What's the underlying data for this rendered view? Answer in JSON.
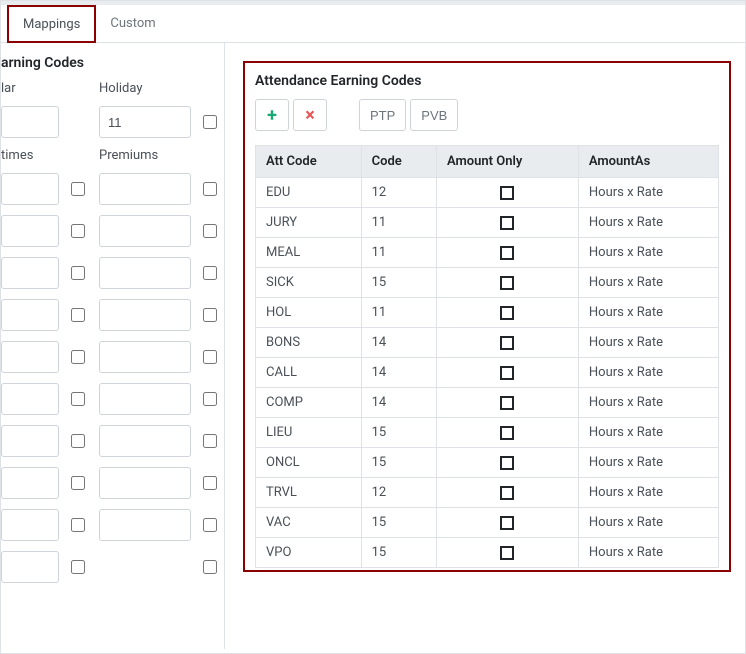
{
  "tabs": {
    "mappings": "Mappings",
    "custom": "Custom"
  },
  "left": {
    "title": "arning Codes",
    "labels": {
      "lar": "lar",
      "holiday": "Holiday",
      "times": "times",
      "premiums": "Premiums"
    },
    "holidayValue": "11"
  },
  "right": {
    "title": "Attendance Earning Codes",
    "addIcon": "+",
    "delIcon": "×",
    "ptp": "PTP",
    "pvb": "PVB",
    "headers": {
      "attCode": "Att Code",
      "code": "Code",
      "amountOnly": "Amount Only",
      "amountAs": "AmountAs"
    },
    "rows": [
      {
        "att": "EDU",
        "code": "12",
        "as": "Hours x Rate"
      },
      {
        "att": "JURY",
        "code": "11",
        "as": "Hours x Rate"
      },
      {
        "att": "MEAL",
        "code": "11",
        "as": "Hours x Rate"
      },
      {
        "att": "SICK",
        "code": "15",
        "as": "Hours x Rate"
      },
      {
        "att": "HOL",
        "code": "11",
        "as": "Hours x Rate"
      },
      {
        "att": "BONS",
        "code": "14",
        "as": "Hours x Rate"
      },
      {
        "att": "CALL",
        "code": "14",
        "as": "Hours x Rate"
      },
      {
        "att": "COMP",
        "code": "14",
        "as": "Hours x Rate"
      },
      {
        "att": "LIEU",
        "code": "15",
        "as": "Hours x Rate"
      },
      {
        "att": "ONCL",
        "code": "15",
        "as": "Hours x Rate"
      },
      {
        "att": "TRVL",
        "code": "12",
        "as": "Hours x Rate"
      },
      {
        "att": "VAC",
        "code": "15",
        "as": "Hours x Rate"
      },
      {
        "att": "VPO",
        "code": "15",
        "as": "Hours x Rate"
      }
    ]
  },
  "colors": {
    "add": "#19a974",
    "del": "#e55353"
  }
}
